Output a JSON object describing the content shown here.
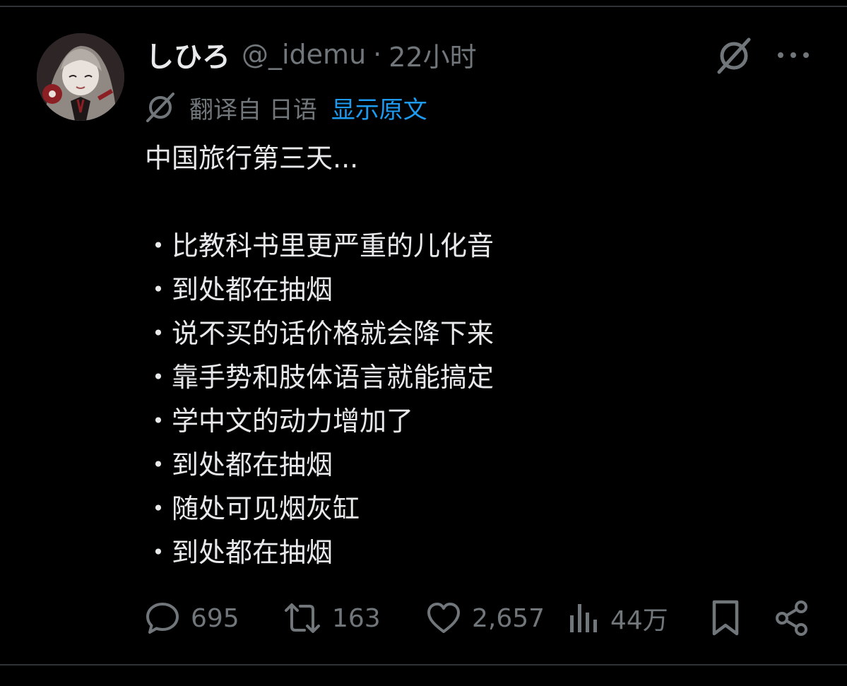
{
  "author": {
    "display_name": "しひろ",
    "handle": "@_idemu",
    "separator": "·",
    "time": "22小时"
  },
  "translation": {
    "translated_from": "翻译自 日语",
    "show_original": "显示原文"
  },
  "tweet": {
    "intro": "中国旅行第三天...",
    "bullets": [
      "・比教科书里更严重的儿化音",
      "・到处都在抽烟",
      "・说不买的话价格就会降下来",
      "・靠手势和肢体语言就能搞定",
      "・学中文的动力增加了",
      "・到处都在抽烟",
      "・随处可见烟灰缸",
      "・到处都在抽烟"
    ]
  },
  "actions": {
    "replies": "695",
    "reposts": "163",
    "likes": "2,657",
    "views": "44万"
  },
  "icons": {
    "reply": "reply-icon",
    "repost": "repost-icon",
    "like": "heart-icon",
    "views": "views-icon",
    "bookmark": "bookmark-icon",
    "share": "share-icon",
    "grok": "grok-icon",
    "more": "more-icon"
  },
  "colors": {
    "background": "#000000",
    "text": "#e7e9ea",
    "muted": "#71767b",
    "link": "#1d9bf0",
    "divider": "#2f3336"
  }
}
